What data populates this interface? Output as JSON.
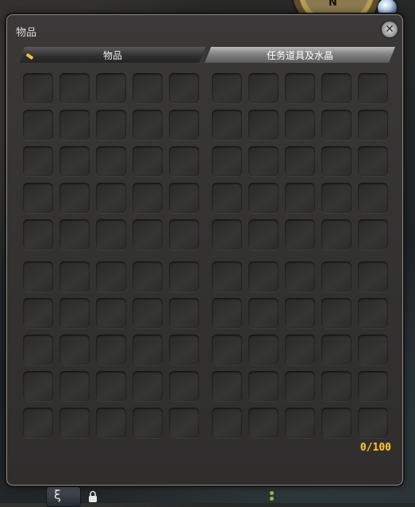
{
  "window": {
    "title": "物品",
    "close_icon": "gear-close-icon"
  },
  "tabs": [
    {
      "label": "物品",
      "active": true
    },
    {
      "label": "任务道具及水晶",
      "active": false
    }
  ],
  "inventory": {
    "used": 0,
    "capacity": 100,
    "count_label": "0/100",
    "grids": 4,
    "rows_per_grid": 5,
    "cols_per_grid": 5
  },
  "background": {
    "compass_label": "N",
    "hotbar_glyph": "ξ"
  },
  "colors": {
    "window_bg": "#343332",
    "slot": "#323231",
    "count_text": "#f2c64d",
    "tab_indicator": "#f0c43c"
  }
}
